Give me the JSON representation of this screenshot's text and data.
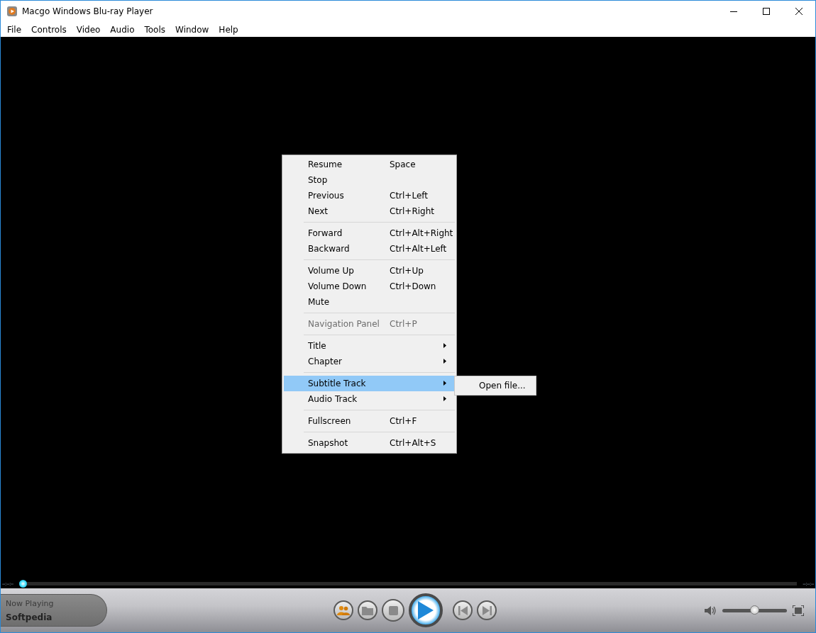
{
  "window": {
    "title": "Macgo Windows Blu-ray Player"
  },
  "menu_bar": [
    {
      "label": "File"
    },
    {
      "label": "Controls"
    },
    {
      "label": "Video"
    },
    {
      "label": "Audio"
    },
    {
      "label": "Tools"
    },
    {
      "label": "Window"
    },
    {
      "label": "Help"
    }
  ],
  "context_menu": {
    "items": [
      {
        "kind": "item",
        "label": "Resume",
        "shortcut": "Space",
        "disabled": false,
        "submenu": false,
        "selected": false
      },
      {
        "kind": "item",
        "label": "Stop",
        "disabled": false,
        "submenu": false,
        "selected": false
      },
      {
        "kind": "item",
        "label": "Previous",
        "shortcut": "Ctrl+Left",
        "disabled": false,
        "submenu": false,
        "selected": false
      },
      {
        "kind": "item",
        "label": "Next",
        "shortcut": "Ctrl+Right",
        "disabled": false,
        "submenu": false,
        "selected": false
      },
      {
        "kind": "separator"
      },
      {
        "kind": "item",
        "label": "Forward",
        "shortcut": "Ctrl+Alt+Right",
        "disabled": false,
        "submenu": false,
        "selected": false
      },
      {
        "kind": "item",
        "label": "Backward",
        "shortcut": "Ctrl+Alt+Left",
        "disabled": false,
        "submenu": false,
        "selected": false
      },
      {
        "kind": "separator"
      },
      {
        "kind": "item",
        "label": "Volume Up",
        "shortcut": "Ctrl+Up",
        "disabled": false,
        "submenu": false,
        "selected": false
      },
      {
        "kind": "item",
        "label": "Volume Down",
        "shortcut": "Ctrl+Down",
        "disabled": false,
        "submenu": false,
        "selected": false
      },
      {
        "kind": "item",
        "label": "Mute",
        "disabled": false,
        "submenu": false,
        "selected": false
      },
      {
        "kind": "separator"
      },
      {
        "kind": "item",
        "label": "Navigation Panel",
        "shortcut": "Ctrl+P",
        "disabled": true,
        "submenu": false,
        "selected": false
      },
      {
        "kind": "separator"
      },
      {
        "kind": "item",
        "label": "Title",
        "disabled": false,
        "submenu": true,
        "selected": false
      },
      {
        "kind": "item",
        "label": "Chapter",
        "disabled": false,
        "submenu": true,
        "selected": false
      },
      {
        "kind": "separator"
      },
      {
        "kind": "item",
        "label": "Subtitle Track",
        "disabled": false,
        "submenu": true,
        "selected": true
      },
      {
        "kind": "item",
        "label": "Audio Track",
        "disabled": false,
        "submenu": true,
        "selected": false
      },
      {
        "kind": "separator"
      },
      {
        "kind": "item",
        "label": "Fullscreen",
        "shortcut": "Ctrl+F",
        "disabled": false,
        "submenu": false,
        "selected": false
      },
      {
        "kind": "separator"
      },
      {
        "kind": "item",
        "label": "Snapshot",
        "shortcut": "Ctrl+Alt+S",
        "disabled": false,
        "submenu": false,
        "selected": false
      }
    ]
  },
  "submenu": {
    "items": [
      {
        "label": "Open file..."
      }
    ]
  },
  "seek_bar": {
    "elapsed": "--:--:--",
    "remaining": "--:--:--",
    "level": 0
  },
  "now_playing": {
    "label": "Now Playing",
    "title": "Softpedia"
  },
  "volume": {
    "level": 0.5
  }
}
